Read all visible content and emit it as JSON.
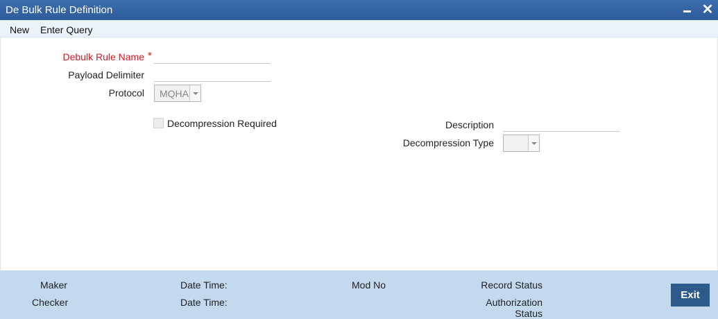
{
  "window": {
    "title": "De Bulk Rule Definition",
    "minimize_icon": "minimize-icon",
    "close_icon": "close-icon"
  },
  "menu": {
    "new_label": "New",
    "enter_query_label": "Enter Query"
  },
  "form": {
    "debulk_rule_name_label": "Debulk Rule Name",
    "required_marker": "*",
    "debulk_rule_name_value": "",
    "payload_delimiter_label": "Payload Delimiter",
    "payload_delimiter_value": "",
    "protocol_label": "Protocol",
    "protocol_value": "MQHA",
    "decompression_required_label": "Decompression Required",
    "decompression_required_checked": false,
    "description_label": "Description",
    "description_value": "",
    "decompression_type_label": "Decompression Type",
    "decompression_type_value": ""
  },
  "footer": {
    "maker_label": "Maker",
    "checker_label": "Checker",
    "date_time_label_1": "Date Time:",
    "date_time_label_2": "Date Time:",
    "mod_no_label": "Mod No",
    "record_status_label": "Record Status",
    "authorization_label": "Authorization",
    "status_label": "Status",
    "exit_label": "Exit"
  },
  "colors": {
    "title_bar": "#2d5a99",
    "menu_bar": "#eaf2fa",
    "footer": "#c3d9ee",
    "required": "#e0141e",
    "exit_button": "#2b5a8b"
  }
}
